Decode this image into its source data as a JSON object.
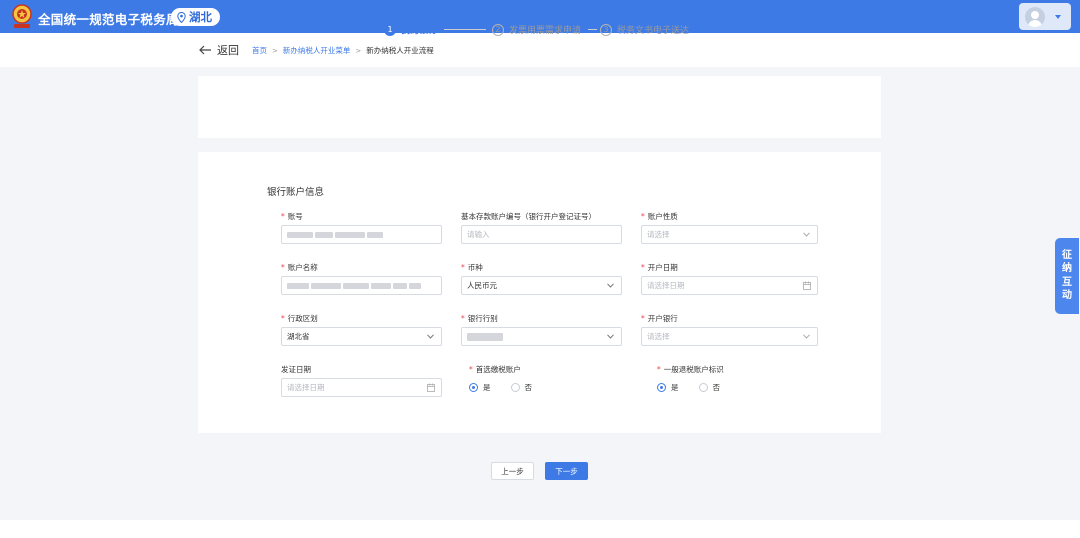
{
  "header": {
    "app_title": "全国统一规范电子税务局",
    "region": "湖北",
    "brand_color": "#3e7ae6"
  },
  "nav": {
    "back_label": "返回",
    "breadcrumb": [
      "首页",
      "新办纳税人开业菜单",
      "新办纳税人开业流程"
    ],
    "separator": ">"
  },
  "steps": [
    {
      "num": "1",
      "label": "我的银行",
      "status": "active"
    },
    {
      "num": "2",
      "label": "发票用票需求申请",
      "status": "todo"
    },
    {
      "num": "3",
      "label": "税务文书电子送达",
      "status": "todo"
    }
  ],
  "form": {
    "section_title": "银行账户信息",
    "fields": {
      "account_no": {
        "label": "账号",
        "required": true,
        "value": ""
      },
      "basic_account_code": {
        "label": "基本存款账户编号（银行开户登记证号）",
        "required": false,
        "placeholder": "请输入"
      },
      "account_nature": {
        "label": "账户性质",
        "required": true,
        "placeholder": "请选择"
      },
      "account_name": {
        "label": "账户名称",
        "required": true,
        "value": ""
      },
      "currency": {
        "label": "币种",
        "required": true,
        "value": "人民币元"
      },
      "open_date": {
        "label": "开户日期",
        "required": true,
        "placeholder": "请选择日期"
      },
      "admin_region": {
        "label": "行政区划",
        "required": true,
        "value": "湖北省"
      },
      "bank_category": {
        "label": "银行行别",
        "required": true,
        "value": ""
      },
      "opening_bank": {
        "label": "开户银行",
        "required": true,
        "placeholder": "请选择"
      },
      "issue_date": {
        "label": "发证日期",
        "required": false,
        "placeholder": "请选择日期"
      },
      "preferred_tax_account": {
        "label": "首选缴税账户",
        "required": true,
        "options": [
          "是",
          "否"
        ],
        "selected": "是"
      },
      "general_refund_account": {
        "label": "一般退税账户标识",
        "required": true,
        "options": [
          "是",
          "否"
        ],
        "selected": "是"
      }
    }
  },
  "buttons": {
    "prev": "上一步",
    "next": "下一步"
  },
  "side_tab": {
    "chars": [
      "征",
      "纳",
      "互",
      "动"
    ]
  },
  "required_mark": "*"
}
